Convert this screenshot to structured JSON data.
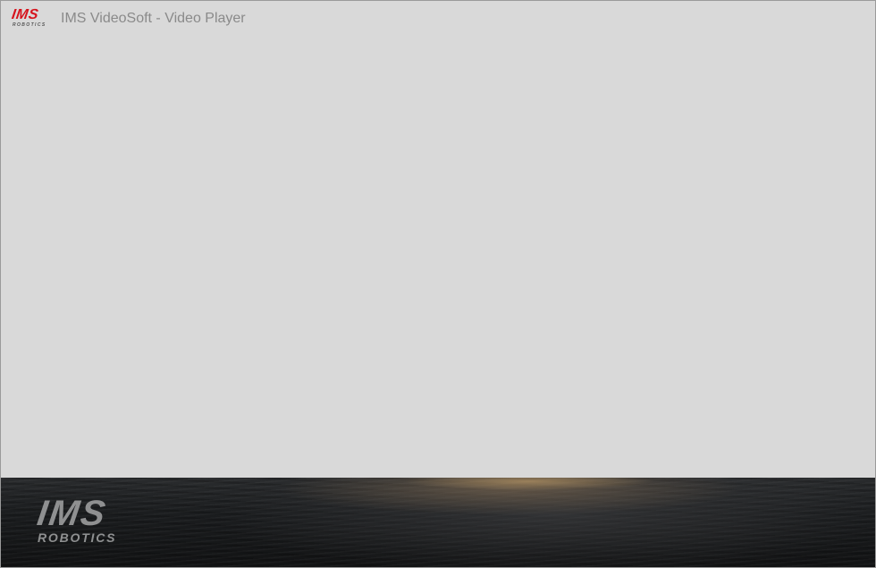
{
  "window": {
    "title": "IMS VideoSoft - Video Player"
  },
  "header_logo": {
    "word": "IMS",
    "sub": "ROBOTICS",
    "color": "#d6141d"
  },
  "footer_logo": {
    "word": "IMS",
    "sub": "ROBOTICS",
    "color": "#8f9091"
  }
}
